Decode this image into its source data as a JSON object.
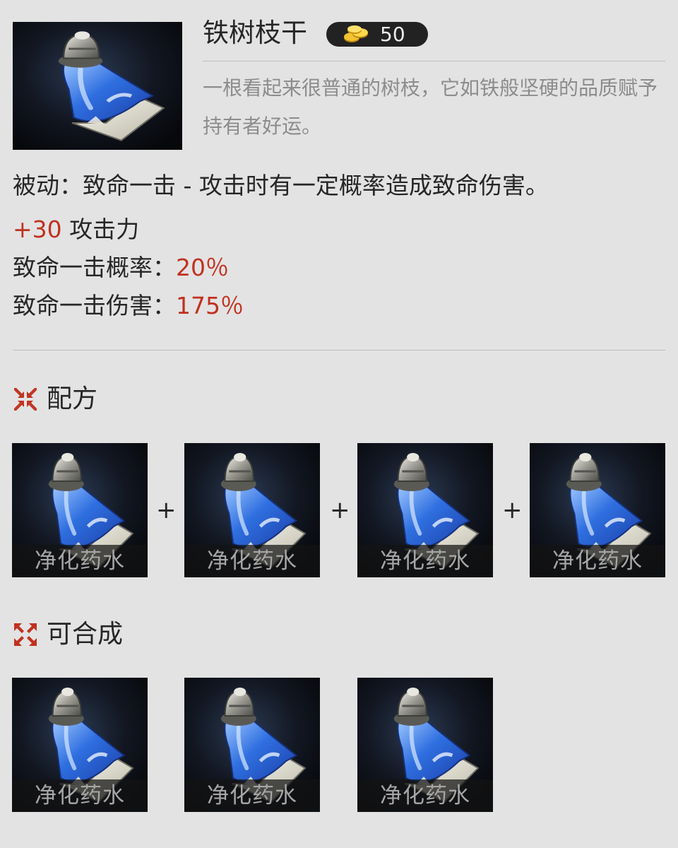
{
  "item": {
    "name": "铁树枝干",
    "price": "50",
    "description": "一根看起来很普通的树枝，它如铁般坚硬的品质赋予持有者好运。",
    "icon": "potion-icon"
  },
  "passive": "被动：致命一击 - 攻击时有一定概率造成致命伤害。",
  "stats": [
    {
      "value": "+30",
      "label": " 攻击力"
    },
    {
      "label": "致命一击概率：",
      "value": "20％"
    },
    {
      "label": "致命一击伤害：",
      "value": "175％"
    }
  ],
  "recipe": {
    "title": "配方",
    "icon": "combine-arrows-icon",
    "plus": "+",
    "items": [
      {
        "name": "净化药水"
      },
      {
        "name": "净化药水"
      },
      {
        "name": "净化药水"
      },
      {
        "name": "净化药水"
      }
    ]
  },
  "builds_into": {
    "title": "可合成",
    "icon": "expand-arrows-icon",
    "items": [
      {
        "name": "净化药水"
      },
      {
        "name": "净化药水"
      },
      {
        "name": "净化药水"
      }
    ]
  },
  "colors": {
    "accent_red": "#c0311f",
    "background": "#e3e3e3",
    "badge": "#222222"
  }
}
